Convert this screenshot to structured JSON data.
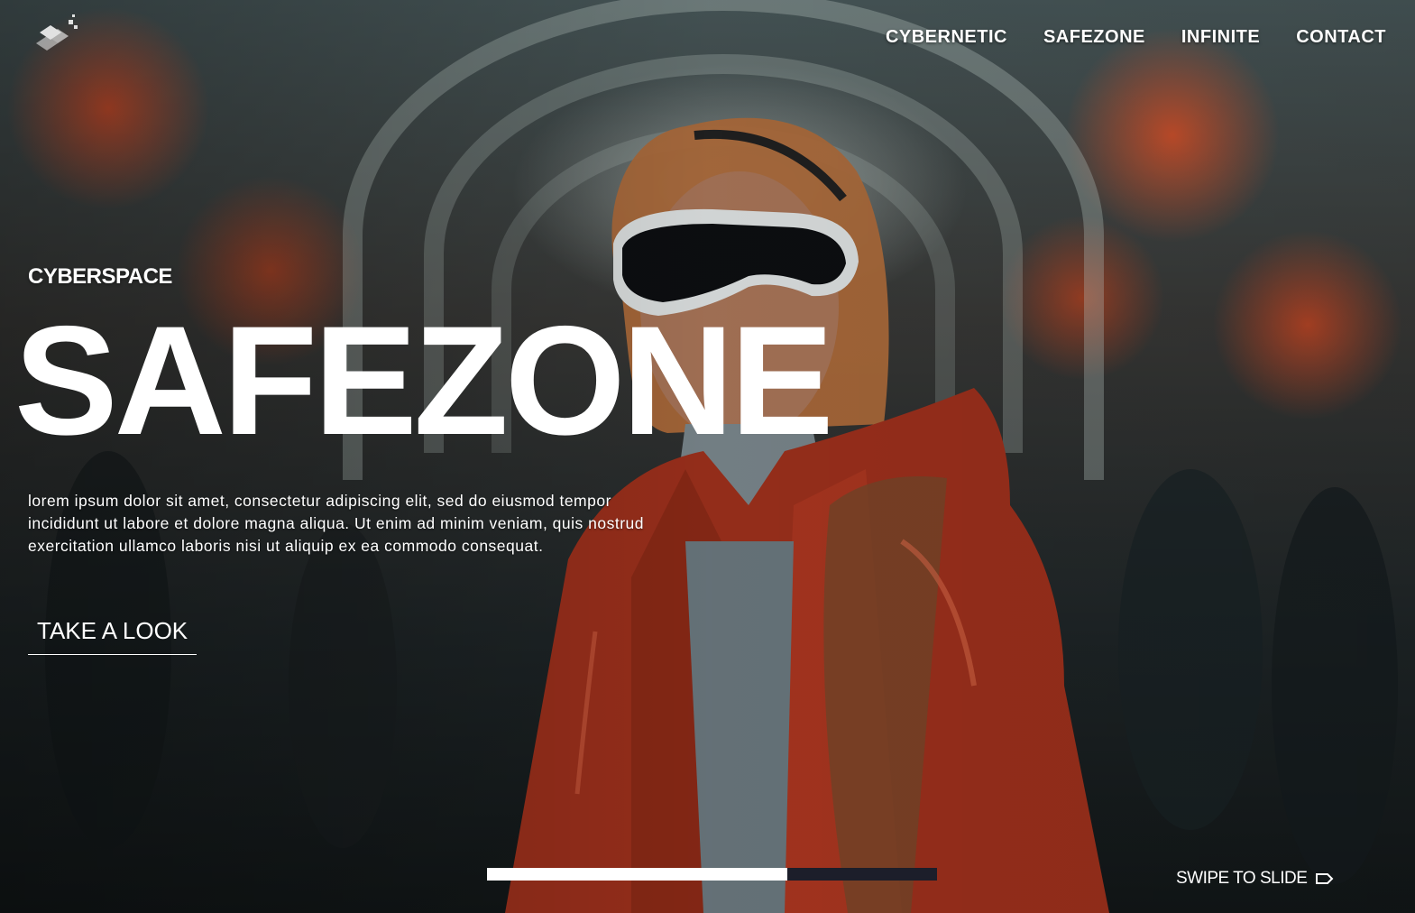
{
  "nav": {
    "items": [
      "CYBERNETIC",
      "SAFEZONE",
      "INFINITE",
      "CONTACT"
    ]
  },
  "hero": {
    "kicker": "CYBERSPACE",
    "headline": "SAFEZONE",
    "description": "lorem ipsum dolor sit amet, consectetur adipiscing elit, sed do eiusmod tempor incididunt ut labore et dolore magna aliqua. Ut enim ad minim veniam, quis nostrud exercitation ullamco laboris nisi ut aliquip ex ea commodo consequat.",
    "cta_label": "TAKE A LOOK"
  },
  "slider": {
    "progress": 0.667,
    "swipe_label": "SWIPE TO SLIDE",
    "swipe_icon": "tag-arrow-icon"
  },
  "logo_icon": "diamond-cube-logo-icon",
  "colors": {
    "text": "#ffffff",
    "progress_track": "#1c1e2a",
    "progress_fill": "#ffffff",
    "accent_orange": "#d9532b"
  }
}
